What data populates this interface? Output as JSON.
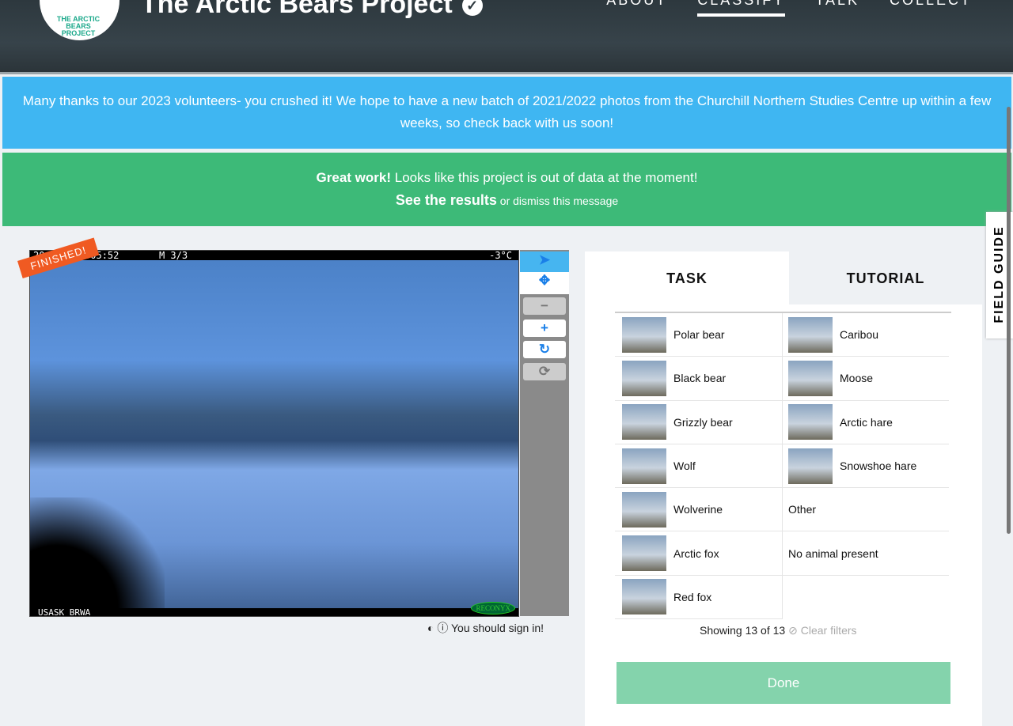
{
  "header": {
    "logo_text": "THE ARCTIC BEARS PROJECT",
    "title": "The Arctic Bears Project",
    "nav": [
      "ABOUT",
      "CLASSIFY",
      "TALK",
      "COLLECT"
    ]
  },
  "banner": {
    "message": "Many thanks to our 2023 volunteers- you crushed it! We hope to have a new batch of 2021/2022 photos from the Churchill Northern Studies Centre up within a few weeks, so check back with us soon!"
  },
  "notice": {
    "bold": "Great work!",
    "text": " Looks like this project is out of data at the moment!",
    "results_link": "See the results",
    "or": " or ",
    "dismiss_link": "dismiss this message"
  },
  "subject": {
    "badge": "FINISHED!",
    "overlay_top": "20  17 09:05:52       M 3/3",
    "temp": "-3°C",
    "overlay_bottom": "USASK BRWA",
    "brand": "RECONYX"
  },
  "signin": "You should sign in!",
  "tabs": {
    "task": "TASK",
    "tutorial": "TUTORIAL"
  },
  "choices_left": [
    "Polar bear",
    "Black bear",
    "Grizzly bear",
    "Wolf",
    "Wolverine",
    "Arctic fox",
    "Red fox"
  ],
  "choices_right": [
    "Caribou",
    "Moose",
    "Arctic hare",
    "Snowshoe hare",
    "Other",
    "No animal present"
  ],
  "showing": "Showing 13 of 13",
  "clear": "Clear filters",
  "done": "Done",
  "field_guide": "FIELD GUIDE"
}
